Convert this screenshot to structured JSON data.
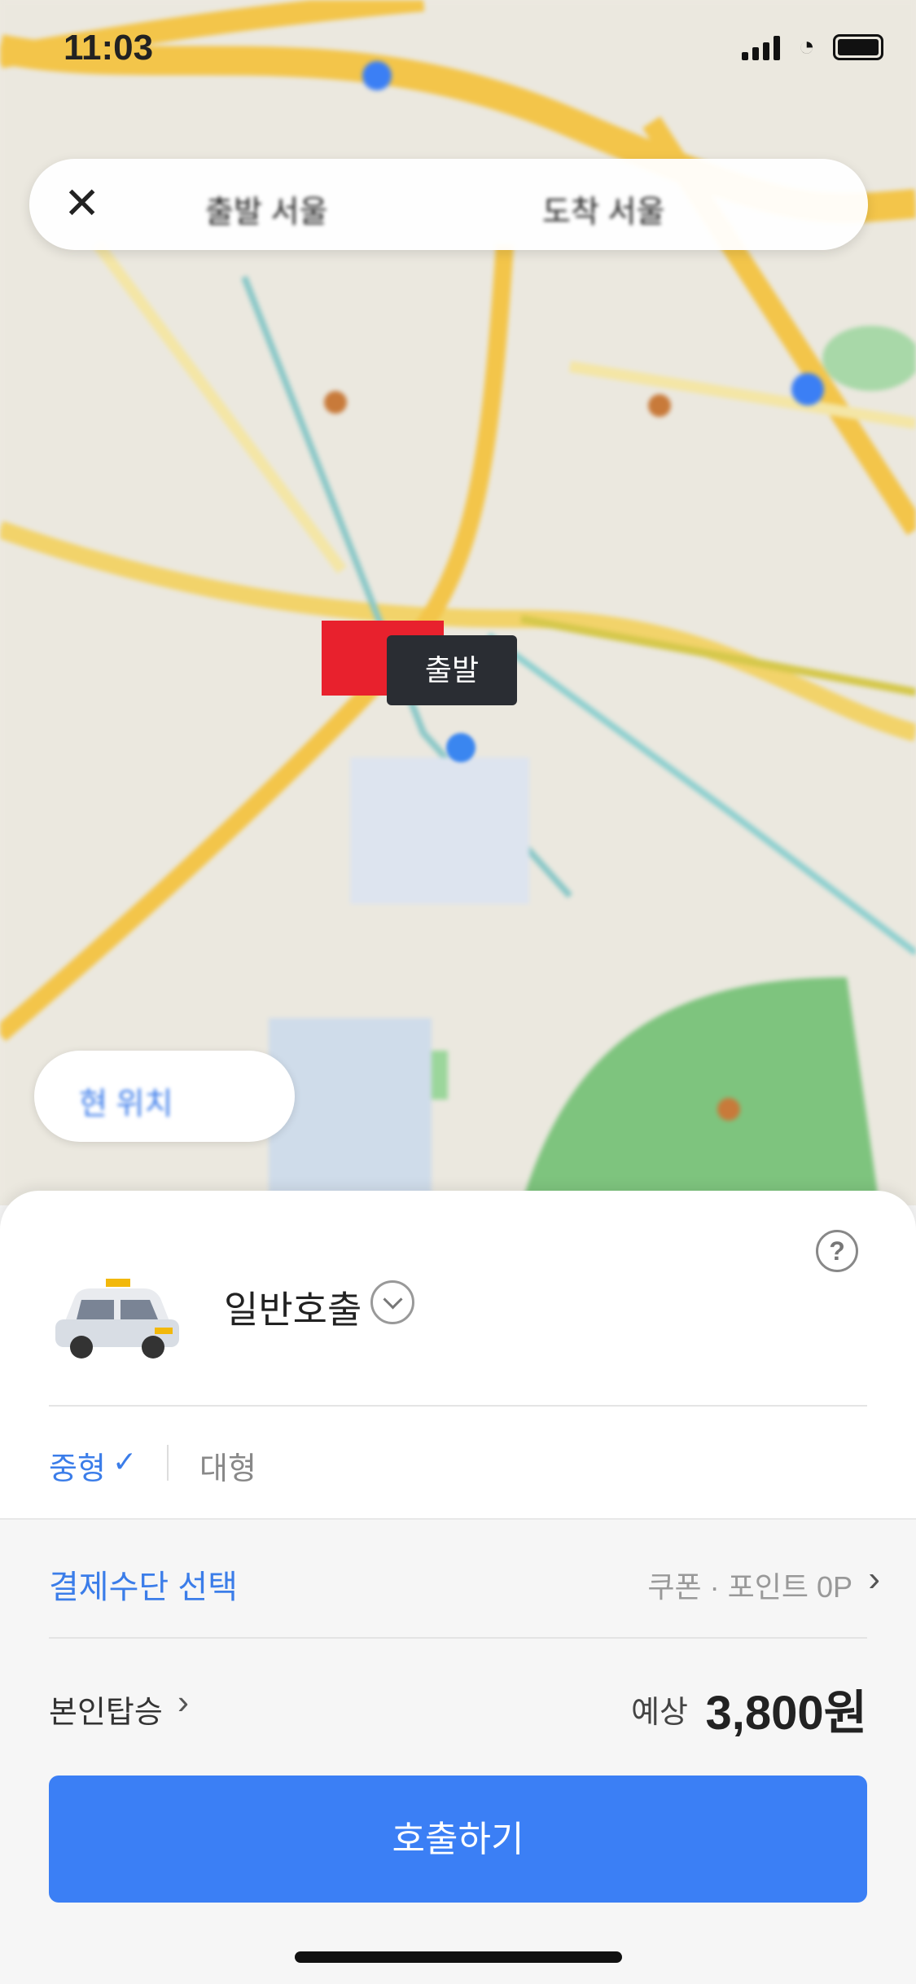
{
  "status_bar": {
    "time": "11:03"
  },
  "route": {
    "close_glyph": "✕",
    "origin": "출발 서울",
    "destination": "도착 서울"
  },
  "map": {
    "pin_label": "출발",
    "chip_label": "현 위치",
    "icons": [
      "close-icon",
      "location-arrow-icon",
      "signal-icon",
      "wifi-icon",
      "battery-icon",
      "taxi-icon",
      "help-icon",
      "chevron-down-icon",
      "check-icon",
      "chevron-right-icon"
    ]
  },
  "sheet": {
    "help_glyph": "?",
    "service_name": "일반호출",
    "sizes": {
      "selected": "중형",
      "other": "대형",
      "check_glyph": "✓"
    },
    "payment": {
      "label": "결제수단 선택",
      "info": "쿠폰 · 포인트 0P",
      "arrow": "›"
    },
    "ride": {
      "label": "본인탑승",
      "arrow": "›"
    },
    "fare": {
      "prefix": "예상",
      "amount": "3,800원"
    },
    "call_button": "호출하기"
  },
  "colors": {
    "accent": "#3b7ff5",
    "pin_red": "#e8212d",
    "map_bg": "#ece9e1"
  }
}
